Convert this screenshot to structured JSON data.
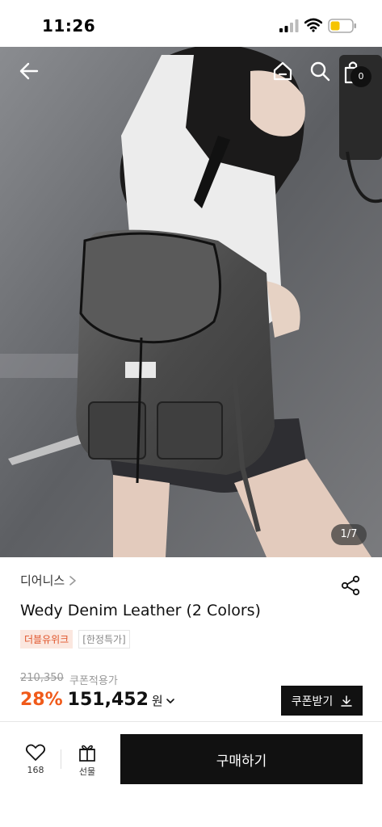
{
  "status_bar": {
    "time": "11:26"
  },
  "header": {
    "cart_count": "0"
  },
  "gallery": {
    "counter": "1/7"
  },
  "product": {
    "brand": "디어니스",
    "title": "Wedy Denim Leather (2 Colors)",
    "tags": [
      "더블유위크",
      "[한정특가]"
    ],
    "original_price": "210,350",
    "coupon_label": "쿠폰적용가",
    "discount": "28%",
    "price": "151,452",
    "currency": "원",
    "coupon_button": "쿠폰받기"
  },
  "bottom_bar": {
    "like_count": "168",
    "gift_label": "선물",
    "buy_label": "구매하기"
  },
  "colors": {
    "accent": "#f05a1a",
    "tag_bg": "#fbe7df",
    "button": "#111111"
  }
}
